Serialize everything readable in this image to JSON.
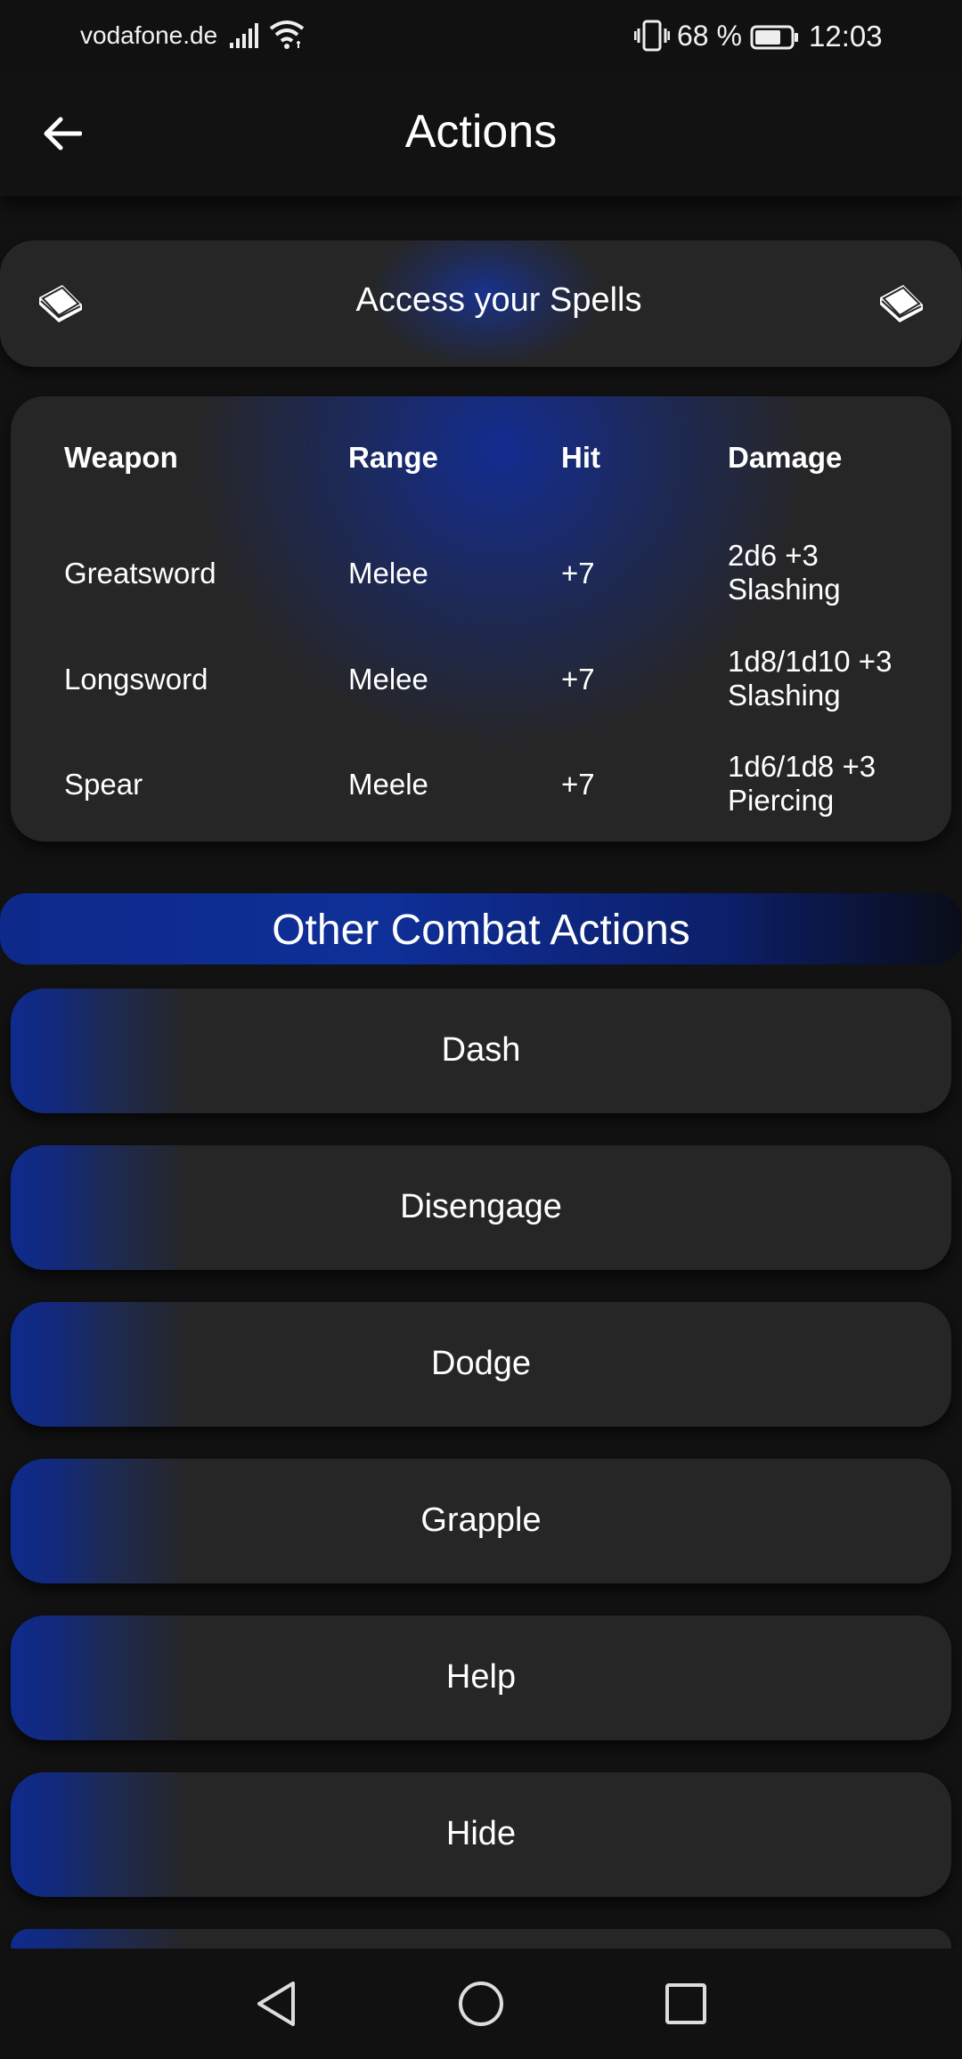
{
  "status_bar": {
    "carrier": "vodafone.de",
    "battery_percent": "68 %",
    "time": "12:03"
  },
  "app_bar": {
    "title": "Actions",
    "back_icon": "arrow-left-icon"
  },
  "spells": {
    "label": "Access your Spells",
    "icon": "book-icon"
  },
  "weapons_table": {
    "headers": [
      "Weapon",
      "Range",
      "Hit",
      "Damage"
    ],
    "rows": [
      {
        "weapon": "Greatsword",
        "range": "Melee",
        "hit": "+7",
        "damage": "2d6 +3 Slashing"
      },
      {
        "weapon": "Longsword",
        "range": "Melee",
        "hit": "+7",
        "damage": "1d8/1d10 +3 Slashing"
      },
      {
        "weapon": "Spear",
        "range": "Meele",
        "hit": "+7",
        "damage": "1d6/1d8 +3 Piercing"
      }
    ]
  },
  "combat_actions": {
    "header": "Other Combat Actions",
    "items": [
      {
        "label": "Dash"
      },
      {
        "label": "Disengage"
      },
      {
        "label": "Dodge"
      },
      {
        "label": "Grapple"
      },
      {
        "label": "Help"
      },
      {
        "label": "Hide"
      }
    ]
  },
  "nav_bar": {
    "back_icon": "triangle-back-icon",
    "home_icon": "circle-home-icon",
    "recents_icon": "square-recents-icon"
  },
  "colors": {
    "background": "#121212",
    "card": "#262626",
    "accent": "#0f2f98"
  }
}
